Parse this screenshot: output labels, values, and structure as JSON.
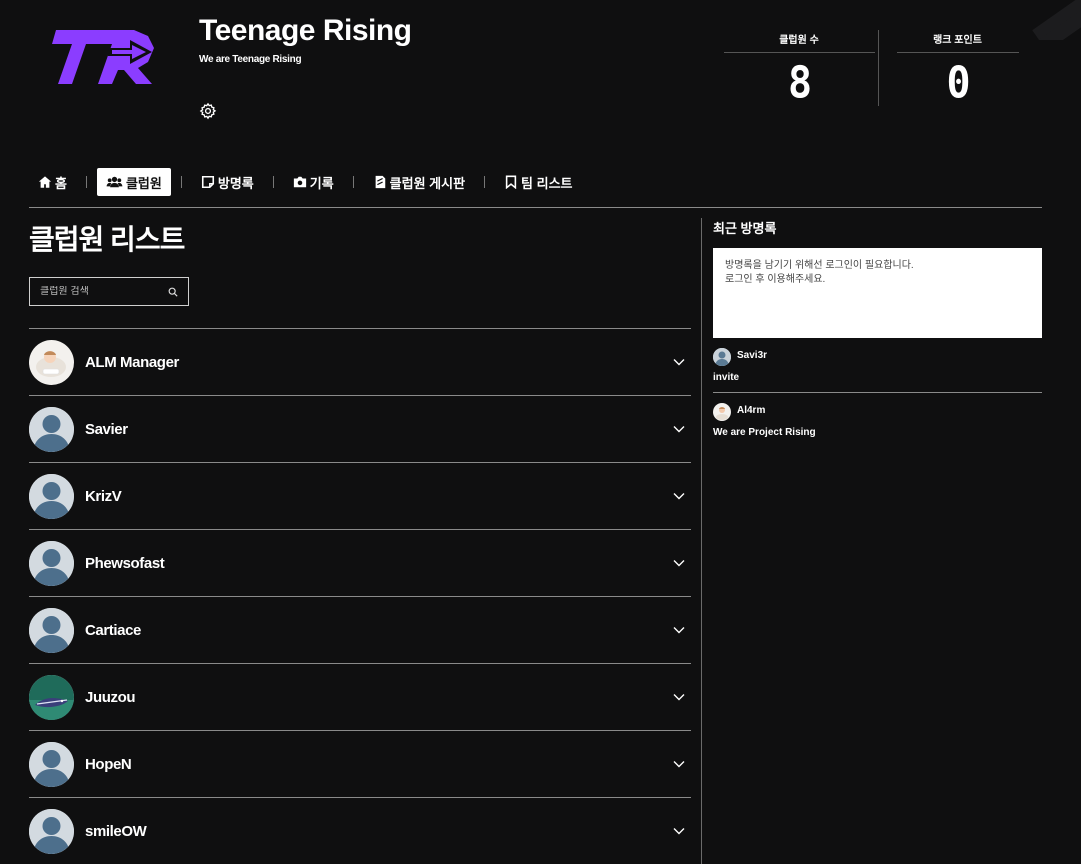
{
  "header": {
    "club_name": "Teenage Rising",
    "tagline": "We are Teenage Rising",
    "logo_text": "TR",
    "brand_color": "#8b3dff"
  },
  "stats": [
    {
      "label": "클럽원 수",
      "value": "8"
    },
    {
      "label": "랭크 포인트",
      "value": "0"
    }
  ],
  "nav": {
    "items": [
      {
        "label": "홈",
        "icon": "home-icon",
        "active": false
      },
      {
        "label": "클럽원",
        "icon": "users-icon",
        "active": true
      },
      {
        "label": "방명록",
        "icon": "note-icon",
        "active": false
      },
      {
        "label": "기록",
        "icon": "camera-icon",
        "active": false
      },
      {
        "label": "클럽원 게시판",
        "icon": "board-icon",
        "active": false
      },
      {
        "label": "팀 리스트",
        "icon": "bookmark-icon",
        "active": false
      }
    ]
  },
  "main": {
    "title": "클럽원 리스트",
    "search_placeholder": "클럽원 검색",
    "members": [
      {
        "name": "ALM Manager",
        "avatar": "custom-light"
      },
      {
        "name": "Savier",
        "avatar": "default"
      },
      {
        "name": "KrizV",
        "avatar": "default"
      },
      {
        "name": "Phewsofast",
        "avatar": "default"
      },
      {
        "name": "Cartiace",
        "avatar": "default"
      },
      {
        "name": "Juuzou",
        "avatar": "custom-fish"
      },
      {
        "name": "HopeN",
        "avatar": "default"
      },
      {
        "name": "smileOW",
        "avatar": "default"
      }
    ]
  },
  "sidebar": {
    "title": "최근 방명록",
    "login_notice": "방명록을 남기기 위해선 로그인이 필요합니다.\n로그인 후 이용해주세요.",
    "entries": [
      {
        "author": "Savi3r",
        "text": "invite"
      },
      {
        "author": "Al4rm",
        "text": "We are Project Rising"
      }
    ]
  }
}
